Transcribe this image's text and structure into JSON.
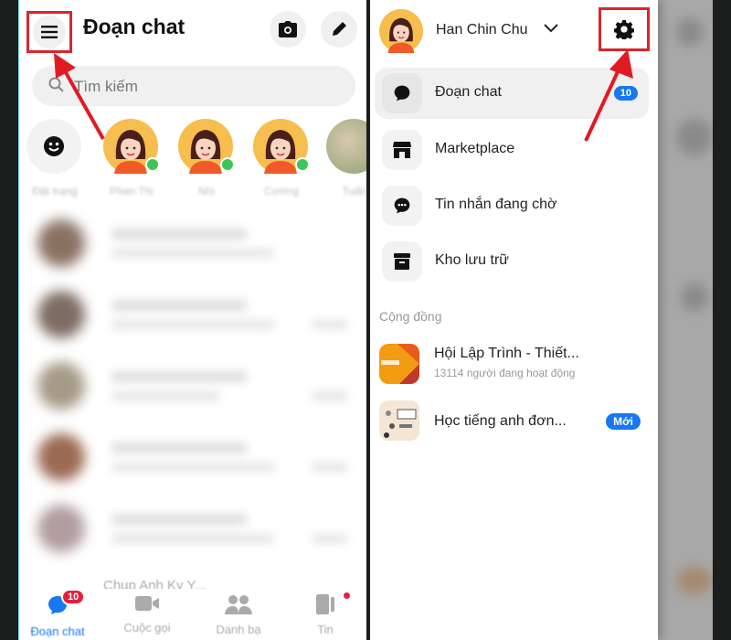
{
  "left": {
    "title": "Đoạn chat",
    "search_placeholder": "Tìm kiếm",
    "stories": [
      {
        "label": "Đặt trạng"
      },
      {
        "label": "Phan Thị"
      },
      {
        "label": "Nhi"
      },
      {
        "label": "Cương"
      },
      {
        "label": "Tuấn"
      }
    ],
    "last_chat_preview": "Chup Anh Ky Y...",
    "nav": [
      {
        "label": "Đoạn chat",
        "badge": "10",
        "active": true
      },
      {
        "label": "Cuộc gọi"
      },
      {
        "label": "Danh bạ"
      },
      {
        "label": "Tin"
      }
    ]
  },
  "drawer": {
    "profile_name": "Han Chin Chu",
    "menu": [
      {
        "label": "Đoạn chat",
        "badge": "10",
        "icon": "chat-bubble-icon"
      },
      {
        "label": "Marketplace",
        "icon": "store-icon"
      },
      {
        "label": "Tin nhắn đang chờ",
        "icon": "message-dots-icon"
      },
      {
        "label": "Kho lưu trữ",
        "icon": "archive-icon"
      }
    ],
    "section_title": "Cộng đồng",
    "communities": [
      {
        "name": "Hội Lập Trình - Thiết...",
        "subtitle": "13114 người đang hoạt động"
      },
      {
        "name": "Học tiếng anh đơn...",
        "badge": "Mới"
      }
    ]
  },
  "colors": {
    "accent": "#1877f2",
    "highlight": "#d9262a",
    "notification": "#e41e3f",
    "online": "#3bc65c"
  }
}
